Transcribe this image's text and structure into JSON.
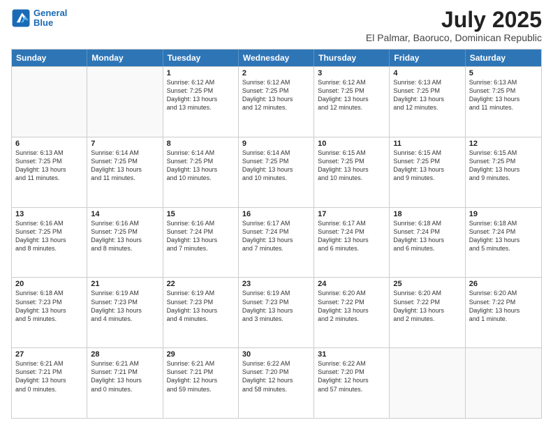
{
  "header": {
    "logo_line1": "General",
    "logo_line2": "Blue",
    "month": "July 2025",
    "location": "El Palmar, Baoruco, Dominican Republic"
  },
  "weekdays": [
    "Sunday",
    "Monday",
    "Tuesday",
    "Wednesday",
    "Thursday",
    "Friday",
    "Saturday"
  ],
  "rows": [
    [
      {
        "day": "",
        "text": ""
      },
      {
        "day": "",
        "text": ""
      },
      {
        "day": "1",
        "text": "Sunrise: 6:12 AM\nSunset: 7:25 PM\nDaylight: 13 hours\nand 13 minutes."
      },
      {
        "day": "2",
        "text": "Sunrise: 6:12 AM\nSunset: 7:25 PM\nDaylight: 13 hours\nand 12 minutes."
      },
      {
        "day": "3",
        "text": "Sunrise: 6:12 AM\nSunset: 7:25 PM\nDaylight: 13 hours\nand 12 minutes."
      },
      {
        "day": "4",
        "text": "Sunrise: 6:13 AM\nSunset: 7:25 PM\nDaylight: 13 hours\nand 12 minutes."
      },
      {
        "day": "5",
        "text": "Sunrise: 6:13 AM\nSunset: 7:25 PM\nDaylight: 13 hours\nand 11 minutes."
      }
    ],
    [
      {
        "day": "6",
        "text": "Sunrise: 6:13 AM\nSunset: 7:25 PM\nDaylight: 13 hours\nand 11 minutes."
      },
      {
        "day": "7",
        "text": "Sunrise: 6:14 AM\nSunset: 7:25 PM\nDaylight: 13 hours\nand 11 minutes."
      },
      {
        "day": "8",
        "text": "Sunrise: 6:14 AM\nSunset: 7:25 PM\nDaylight: 13 hours\nand 10 minutes."
      },
      {
        "day": "9",
        "text": "Sunrise: 6:14 AM\nSunset: 7:25 PM\nDaylight: 13 hours\nand 10 minutes."
      },
      {
        "day": "10",
        "text": "Sunrise: 6:15 AM\nSunset: 7:25 PM\nDaylight: 13 hours\nand 10 minutes."
      },
      {
        "day": "11",
        "text": "Sunrise: 6:15 AM\nSunset: 7:25 PM\nDaylight: 13 hours\nand 9 minutes."
      },
      {
        "day": "12",
        "text": "Sunrise: 6:15 AM\nSunset: 7:25 PM\nDaylight: 13 hours\nand 9 minutes."
      }
    ],
    [
      {
        "day": "13",
        "text": "Sunrise: 6:16 AM\nSunset: 7:25 PM\nDaylight: 13 hours\nand 8 minutes."
      },
      {
        "day": "14",
        "text": "Sunrise: 6:16 AM\nSunset: 7:25 PM\nDaylight: 13 hours\nand 8 minutes."
      },
      {
        "day": "15",
        "text": "Sunrise: 6:16 AM\nSunset: 7:24 PM\nDaylight: 13 hours\nand 7 minutes."
      },
      {
        "day": "16",
        "text": "Sunrise: 6:17 AM\nSunset: 7:24 PM\nDaylight: 13 hours\nand 7 minutes."
      },
      {
        "day": "17",
        "text": "Sunrise: 6:17 AM\nSunset: 7:24 PM\nDaylight: 13 hours\nand 6 minutes."
      },
      {
        "day": "18",
        "text": "Sunrise: 6:18 AM\nSunset: 7:24 PM\nDaylight: 13 hours\nand 6 minutes."
      },
      {
        "day": "19",
        "text": "Sunrise: 6:18 AM\nSunset: 7:24 PM\nDaylight: 13 hours\nand 5 minutes."
      }
    ],
    [
      {
        "day": "20",
        "text": "Sunrise: 6:18 AM\nSunset: 7:23 PM\nDaylight: 13 hours\nand 5 minutes."
      },
      {
        "day": "21",
        "text": "Sunrise: 6:19 AM\nSunset: 7:23 PM\nDaylight: 13 hours\nand 4 minutes."
      },
      {
        "day": "22",
        "text": "Sunrise: 6:19 AM\nSunset: 7:23 PM\nDaylight: 13 hours\nand 4 minutes."
      },
      {
        "day": "23",
        "text": "Sunrise: 6:19 AM\nSunset: 7:23 PM\nDaylight: 13 hours\nand 3 minutes."
      },
      {
        "day": "24",
        "text": "Sunrise: 6:20 AM\nSunset: 7:22 PM\nDaylight: 13 hours\nand 2 minutes."
      },
      {
        "day": "25",
        "text": "Sunrise: 6:20 AM\nSunset: 7:22 PM\nDaylight: 13 hours\nand 2 minutes."
      },
      {
        "day": "26",
        "text": "Sunrise: 6:20 AM\nSunset: 7:22 PM\nDaylight: 13 hours\nand 1 minute."
      }
    ],
    [
      {
        "day": "27",
        "text": "Sunrise: 6:21 AM\nSunset: 7:21 PM\nDaylight: 13 hours\nand 0 minutes."
      },
      {
        "day": "28",
        "text": "Sunrise: 6:21 AM\nSunset: 7:21 PM\nDaylight: 13 hours\nand 0 minutes."
      },
      {
        "day": "29",
        "text": "Sunrise: 6:21 AM\nSunset: 7:21 PM\nDaylight: 12 hours\nand 59 minutes."
      },
      {
        "day": "30",
        "text": "Sunrise: 6:22 AM\nSunset: 7:20 PM\nDaylight: 12 hours\nand 58 minutes."
      },
      {
        "day": "31",
        "text": "Sunrise: 6:22 AM\nSunset: 7:20 PM\nDaylight: 12 hours\nand 57 minutes."
      },
      {
        "day": "",
        "text": ""
      },
      {
        "day": "",
        "text": ""
      }
    ]
  ]
}
